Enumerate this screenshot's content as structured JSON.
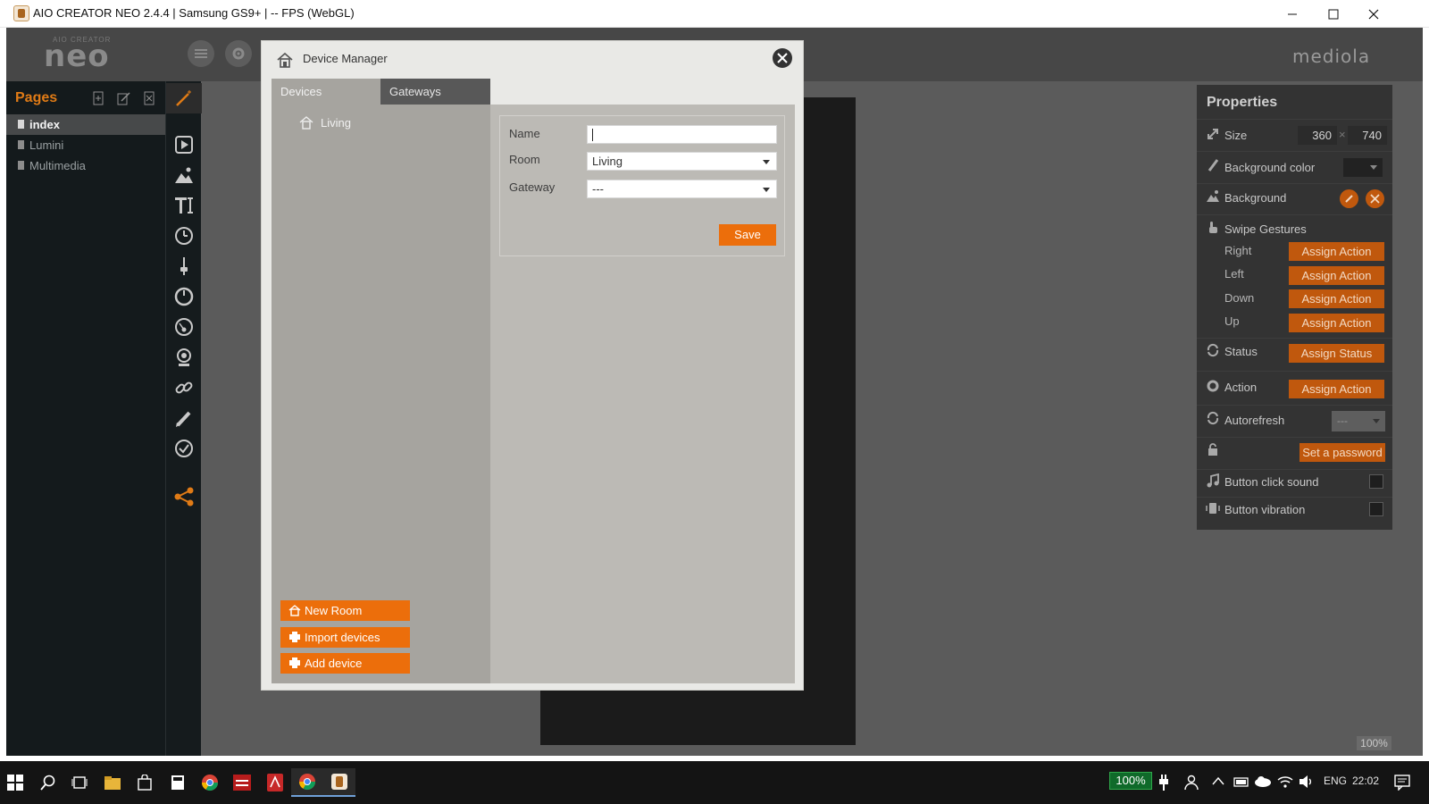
{
  "window": {
    "title": "AIO CREATOR NEO 2.4.4 | Samsung GS9+ | -- FPS (WebGL)",
    "minimize_icon": "minimize-icon",
    "maximize_icon": "maximize-icon",
    "close_icon": "close-icon"
  },
  "topbar": {
    "brand": "mediola",
    "logo_top": "AIO CREATOR",
    "logo_main": "neo"
  },
  "pages_panel": {
    "title": "Pages",
    "tools": [
      "add-page-icon",
      "edit-page-icon",
      "delete-page-icon"
    ],
    "items": [
      {
        "label": "index",
        "selected": true
      },
      {
        "label": "Lumini",
        "selected": false
      },
      {
        "label": "Multimedia",
        "selected": false
      }
    ]
  },
  "toolbox": {
    "tools": [
      "magic-wand-icon",
      "play-icon",
      "image-icon",
      "text-icon",
      "clock-icon",
      "slider-icon",
      "knob-icon",
      "gauge-icon",
      "webcam-icon",
      "link-icon",
      "pen-icon",
      "check-icon",
      "share-icon"
    ]
  },
  "canvas": {
    "zoom": "100%"
  },
  "properties": {
    "title": "Properties",
    "size_label": "Size",
    "width": "360",
    "height": "740",
    "size_sep": "×",
    "bg_color_label": "Background color",
    "background_label": "Background",
    "swipe_label": "Swipe Gestures",
    "swipes": [
      {
        "dir": "Right",
        "btn": "Assign Action"
      },
      {
        "dir": "Left",
        "btn": "Assign Action"
      },
      {
        "dir": "Down",
        "btn": "Assign Action"
      },
      {
        "dir": "Up",
        "btn": "Assign Action"
      }
    ],
    "status_label": "Status",
    "status_btn": "Assign Status",
    "action_label": "Action",
    "action_btn": "Assign Action",
    "autorefresh_label": "Autorefresh",
    "autorefresh_value": "---",
    "password_btn": "Set a password",
    "click_sound_label": "Button click sound",
    "vibration_label": "Button vibration"
  },
  "dialog": {
    "title": "Device Manager",
    "tabs": [
      {
        "label": "Devices",
        "active": true
      },
      {
        "label": "Gateways",
        "active": false
      }
    ],
    "tree": [
      {
        "label": "Living",
        "icon": "home-icon"
      }
    ],
    "form": {
      "name_label": "Name",
      "name_value": "",
      "room_label": "Room",
      "room_value": "Living",
      "gateway_label": "Gateway",
      "gateway_value": "---",
      "save_label": "Save"
    },
    "buttons": {
      "new_room": "New Room",
      "import_devices": "Import devices",
      "add_device": "Add device"
    }
  },
  "taskbar": {
    "battery": "100%",
    "language": "ENG",
    "time": "22:02"
  },
  "colors": {
    "accent": "#ec6e0b",
    "panel_dark": "#141a1c",
    "props_bg": "#333333"
  }
}
